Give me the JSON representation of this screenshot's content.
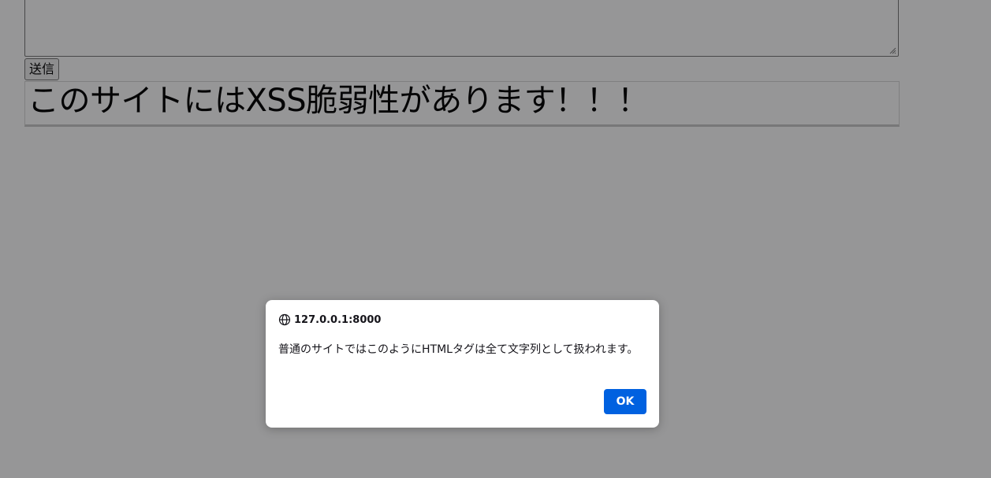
{
  "form": {
    "textarea_value": "",
    "submit_label": "送信"
  },
  "posts": [
    {
      "heading": "このサイトにはXSS脆弱性があります！！！"
    }
  ],
  "alert_dialog": {
    "origin": "127.0.0.1:8000",
    "origin_icon": "globe-icon",
    "message": "普通のサイトではこのようにHTMLタグは全て文字列として扱われます。",
    "ok_label": "OK",
    "ok_color": "#0061e0"
  }
}
